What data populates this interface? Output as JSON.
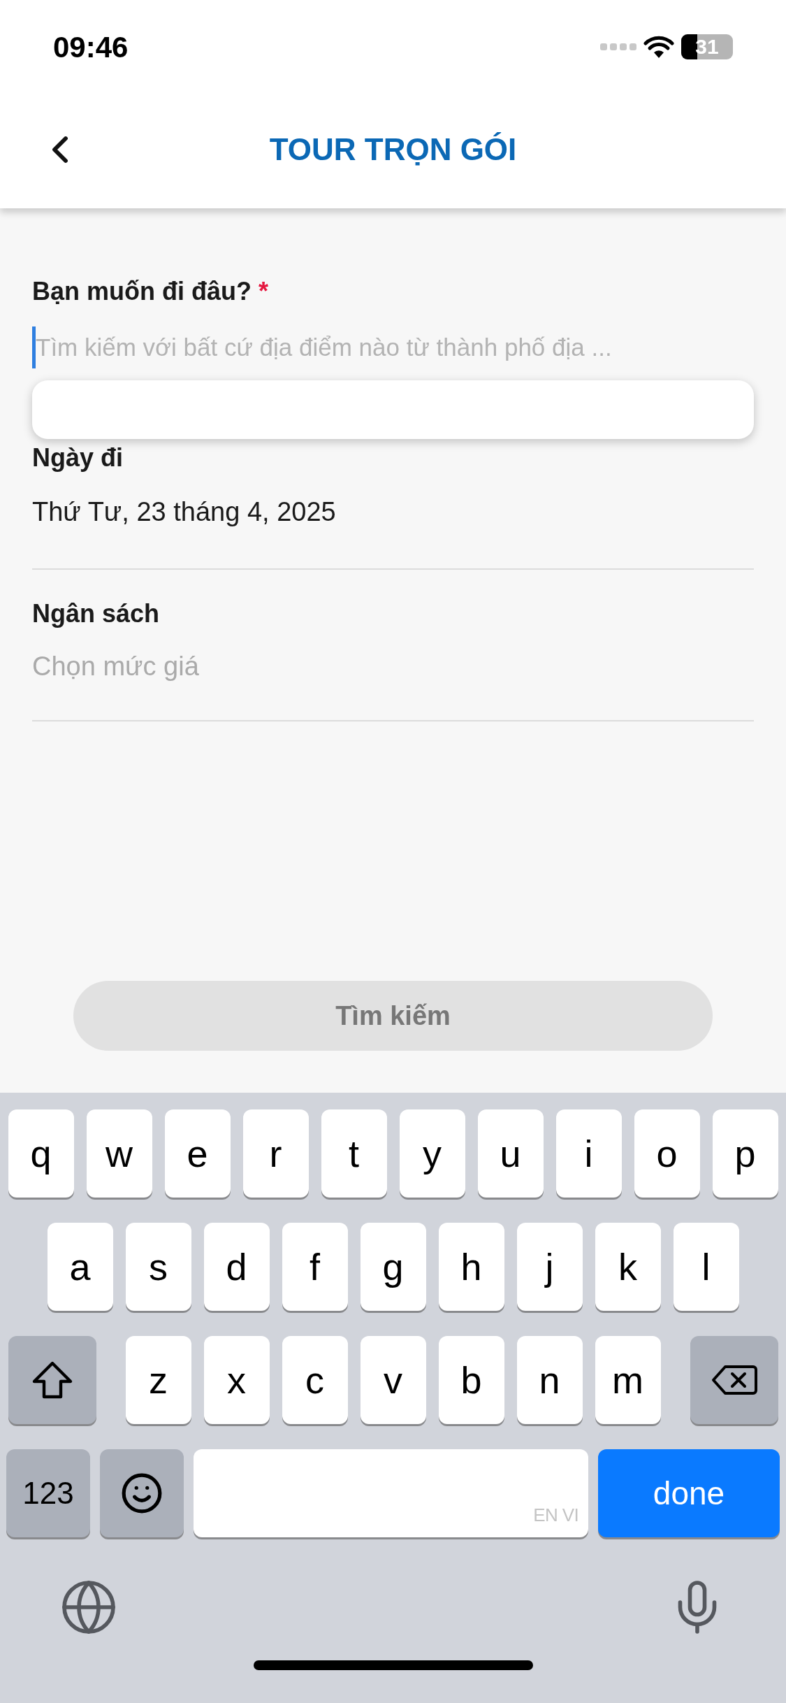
{
  "status_bar": {
    "time": "09:46",
    "battery": "31"
  },
  "nav": {
    "title": "TOUR TRỌN GÓI"
  },
  "form": {
    "destination": {
      "label": "Bạn muốn đi đâu?",
      "required_mark": "*",
      "placeholder": "Tìm kiếm với bất cứ địa điểm nào từ thành phố địa ...",
      "focused": true
    },
    "fields": [
      {
        "kind": "value",
        "label": "Ngày đi",
        "value": "Thứ Tư, 23 tháng 4, 2025"
      },
      {
        "kind": "placeholder",
        "label": "Ngân sách",
        "placeholder": "Chọn mức giá"
      }
    ]
  },
  "search_button": {
    "label": "Tìm kiếm",
    "disabled": true
  },
  "keyboard": {
    "letter_rows": [
      [
        {
          "kind": "letter",
          "label": "q"
        },
        {
          "kind": "letter",
          "label": "w"
        },
        {
          "kind": "letter",
          "label": "e"
        },
        {
          "kind": "letter",
          "label": "r"
        },
        {
          "kind": "letter",
          "label": "t"
        },
        {
          "kind": "letter",
          "label": "y"
        },
        {
          "kind": "letter",
          "label": "u"
        },
        {
          "kind": "letter",
          "label": "i"
        },
        {
          "kind": "letter",
          "label": "o"
        },
        {
          "kind": "letter",
          "label": "p"
        }
      ],
      [
        {
          "kind": "letter",
          "label": "a"
        },
        {
          "kind": "letter",
          "label": "s"
        },
        {
          "kind": "letter",
          "label": "d"
        },
        {
          "kind": "letter",
          "label": "f"
        },
        {
          "kind": "letter",
          "label": "g"
        },
        {
          "kind": "letter",
          "label": "h"
        },
        {
          "kind": "letter",
          "label": "j"
        },
        {
          "kind": "letter",
          "label": "k"
        },
        {
          "kind": "letter",
          "label": "l"
        }
      ],
      [
        {
          "kind": "shift"
        },
        {
          "kind": "letter",
          "label": "z"
        },
        {
          "kind": "letter",
          "label": "x"
        },
        {
          "kind": "letter",
          "label": "c"
        },
        {
          "kind": "letter",
          "label": "v"
        },
        {
          "kind": "letter",
          "label": "b"
        },
        {
          "kind": "letter",
          "label": "n"
        },
        {
          "kind": "letter",
          "label": "m"
        },
        {
          "kind": "delete"
        }
      ]
    ],
    "bottom_row": [
      {
        "kind": "numbers",
        "label": "123"
      },
      {
        "kind": "emoji"
      },
      {
        "kind": "space",
        "label": "EN VI"
      },
      {
        "kind": "return",
        "label": "done"
      }
    ]
  }
}
